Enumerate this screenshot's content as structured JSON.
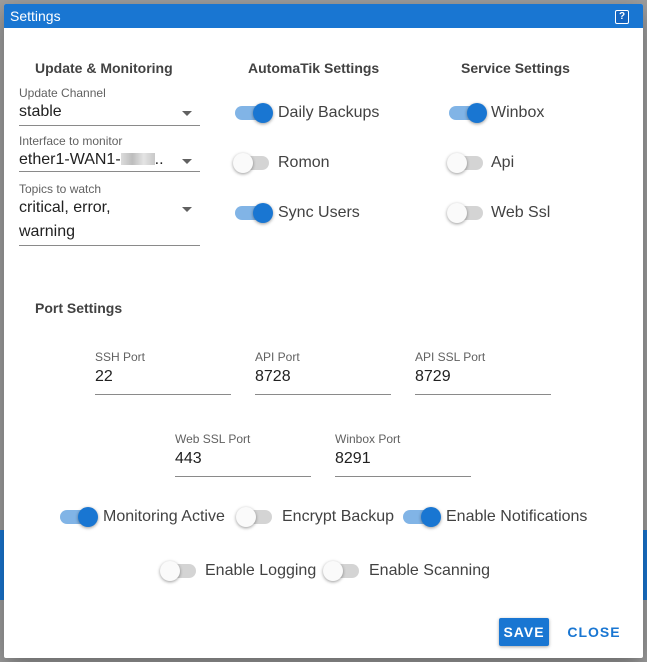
{
  "dialog": {
    "title": "Settings",
    "help_icon_glyph": "?"
  },
  "update_monitoring": {
    "heading": "Update & Monitoring",
    "update_channel": {
      "label": "Update Channel",
      "value": "stable"
    },
    "interface": {
      "label": "Interface to monitor",
      "value_prefix": "ether1-WAN1-",
      "value_suffix": ".."
    },
    "topics": {
      "label": "Topics to watch",
      "value_line1": "critical, error,",
      "value_line2": "warning"
    }
  },
  "automatik": {
    "heading": "AutomaTik Settings",
    "toggles": [
      {
        "label": "Daily Backups",
        "on": true
      },
      {
        "label": "Romon",
        "on": false
      },
      {
        "label": "Sync Users",
        "on": true
      }
    ]
  },
  "service": {
    "heading": "Service Settings",
    "toggles": [
      {
        "label": "Winbox",
        "on": true
      },
      {
        "label": "Api",
        "on": false
      },
      {
        "label": "Web Ssl",
        "on": false
      }
    ]
  },
  "ports": {
    "heading": "Port Settings",
    "ssh": {
      "label": "SSH Port",
      "value": "22"
    },
    "api": {
      "label": "API Port",
      "value": "8728"
    },
    "api_ssl": {
      "label": "API SSL Port",
      "value": "8729"
    },
    "web_ssl": {
      "label": "Web SSL Port",
      "value": "443"
    },
    "winbox": {
      "label": "Winbox Port",
      "value": "8291"
    }
  },
  "general_toggles": [
    {
      "label": "Monitoring Active",
      "on": true
    },
    {
      "label": "Encrypt Backup",
      "on": false
    },
    {
      "label": "Enable Notifications",
      "on": true
    },
    {
      "label": "Enable Logging",
      "on": false
    },
    {
      "label": "Enable Scanning",
      "on": false
    }
  ],
  "actions": {
    "save_label": "SAVE",
    "close_label": "CLOSE"
  },
  "colors": {
    "primary": "#1976d2",
    "switch_off": "#bdbdbd"
  },
  "icons": {
    "help": "help-icon",
    "dropdown": "chevron-down-icon"
  }
}
